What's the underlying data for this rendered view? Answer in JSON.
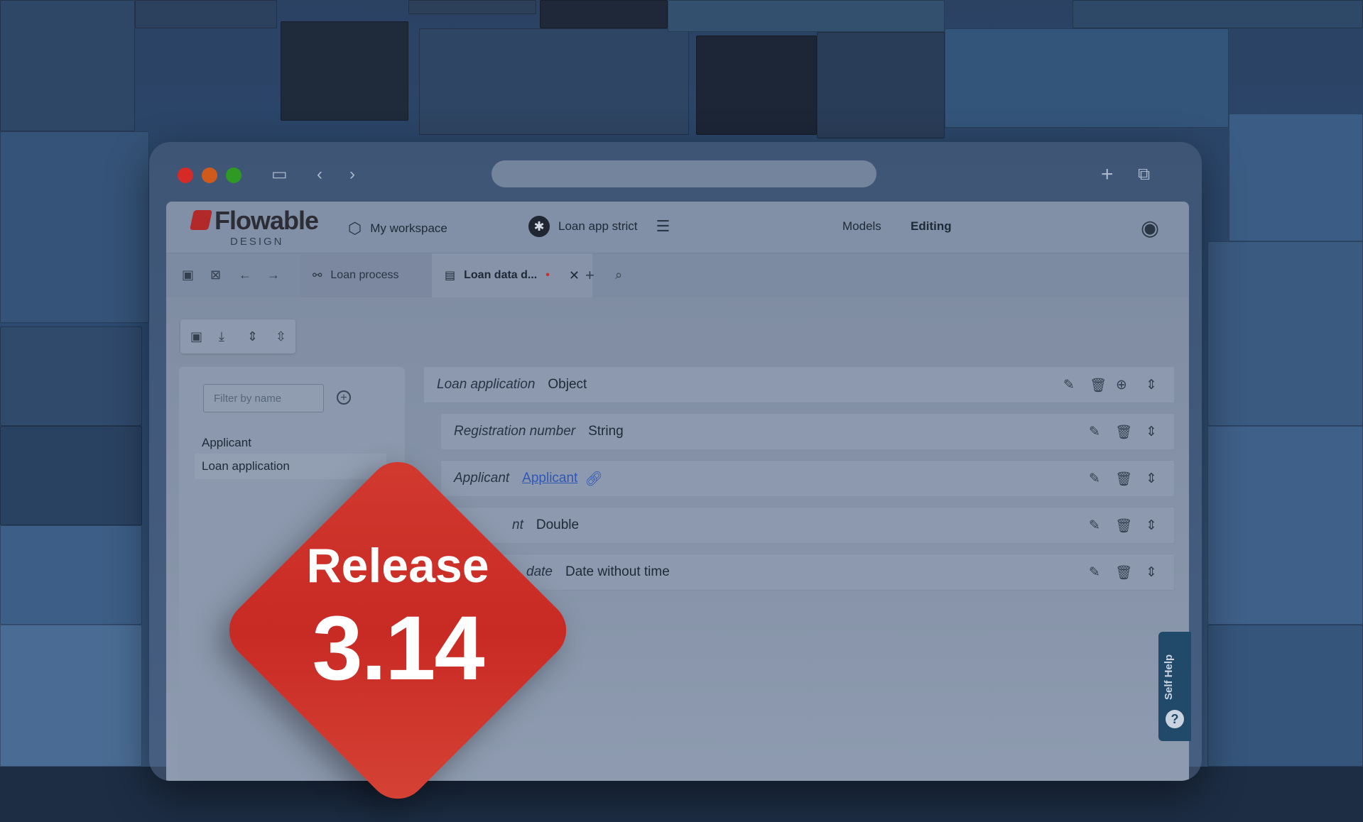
{
  "app": {
    "logo_text": "Flowable",
    "logo_sub": "DESIGN",
    "workspace": "My workspace",
    "app_name": "Loan app strict",
    "nav_models": "Models",
    "nav_editing": "Editing"
  },
  "tabs": [
    {
      "label": "Loan process",
      "icon": "process-icon"
    },
    {
      "label": "Loan data d...",
      "icon": "data-object-icon",
      "modified": "•"
    }
  ],
  "sidebar": {
    "filter_placeholder": "Filter by name",
    "items": [
      {
        "label": "Applicant"
      },
      {
        "label": "Loan application"
      }
    ]
  },
  "fields": [
    {
      "name": "Loan application",
      "type": "Object"
    },
    {
      "name": "Registration number",
      "type": "String"
    },
    {
      "name": "Applicant",
      "type": "Applicant"
    },
    {
      "name": "nt",
      "type": "Double"
    },
    {
      "name": "date",
      "type": "Date without time"
    }
  ],
  "self_help": {
    "label": "Self Help",
    "icon": "?"
  },
  "badge": {
    "title": "Release",
    "version": "3.14"
  },
  "colors": {
    "badge_red": "#d23a30",
    "link_blue": "#2f57b8",
    "self_help_bg": "#20496a"
  }
}
